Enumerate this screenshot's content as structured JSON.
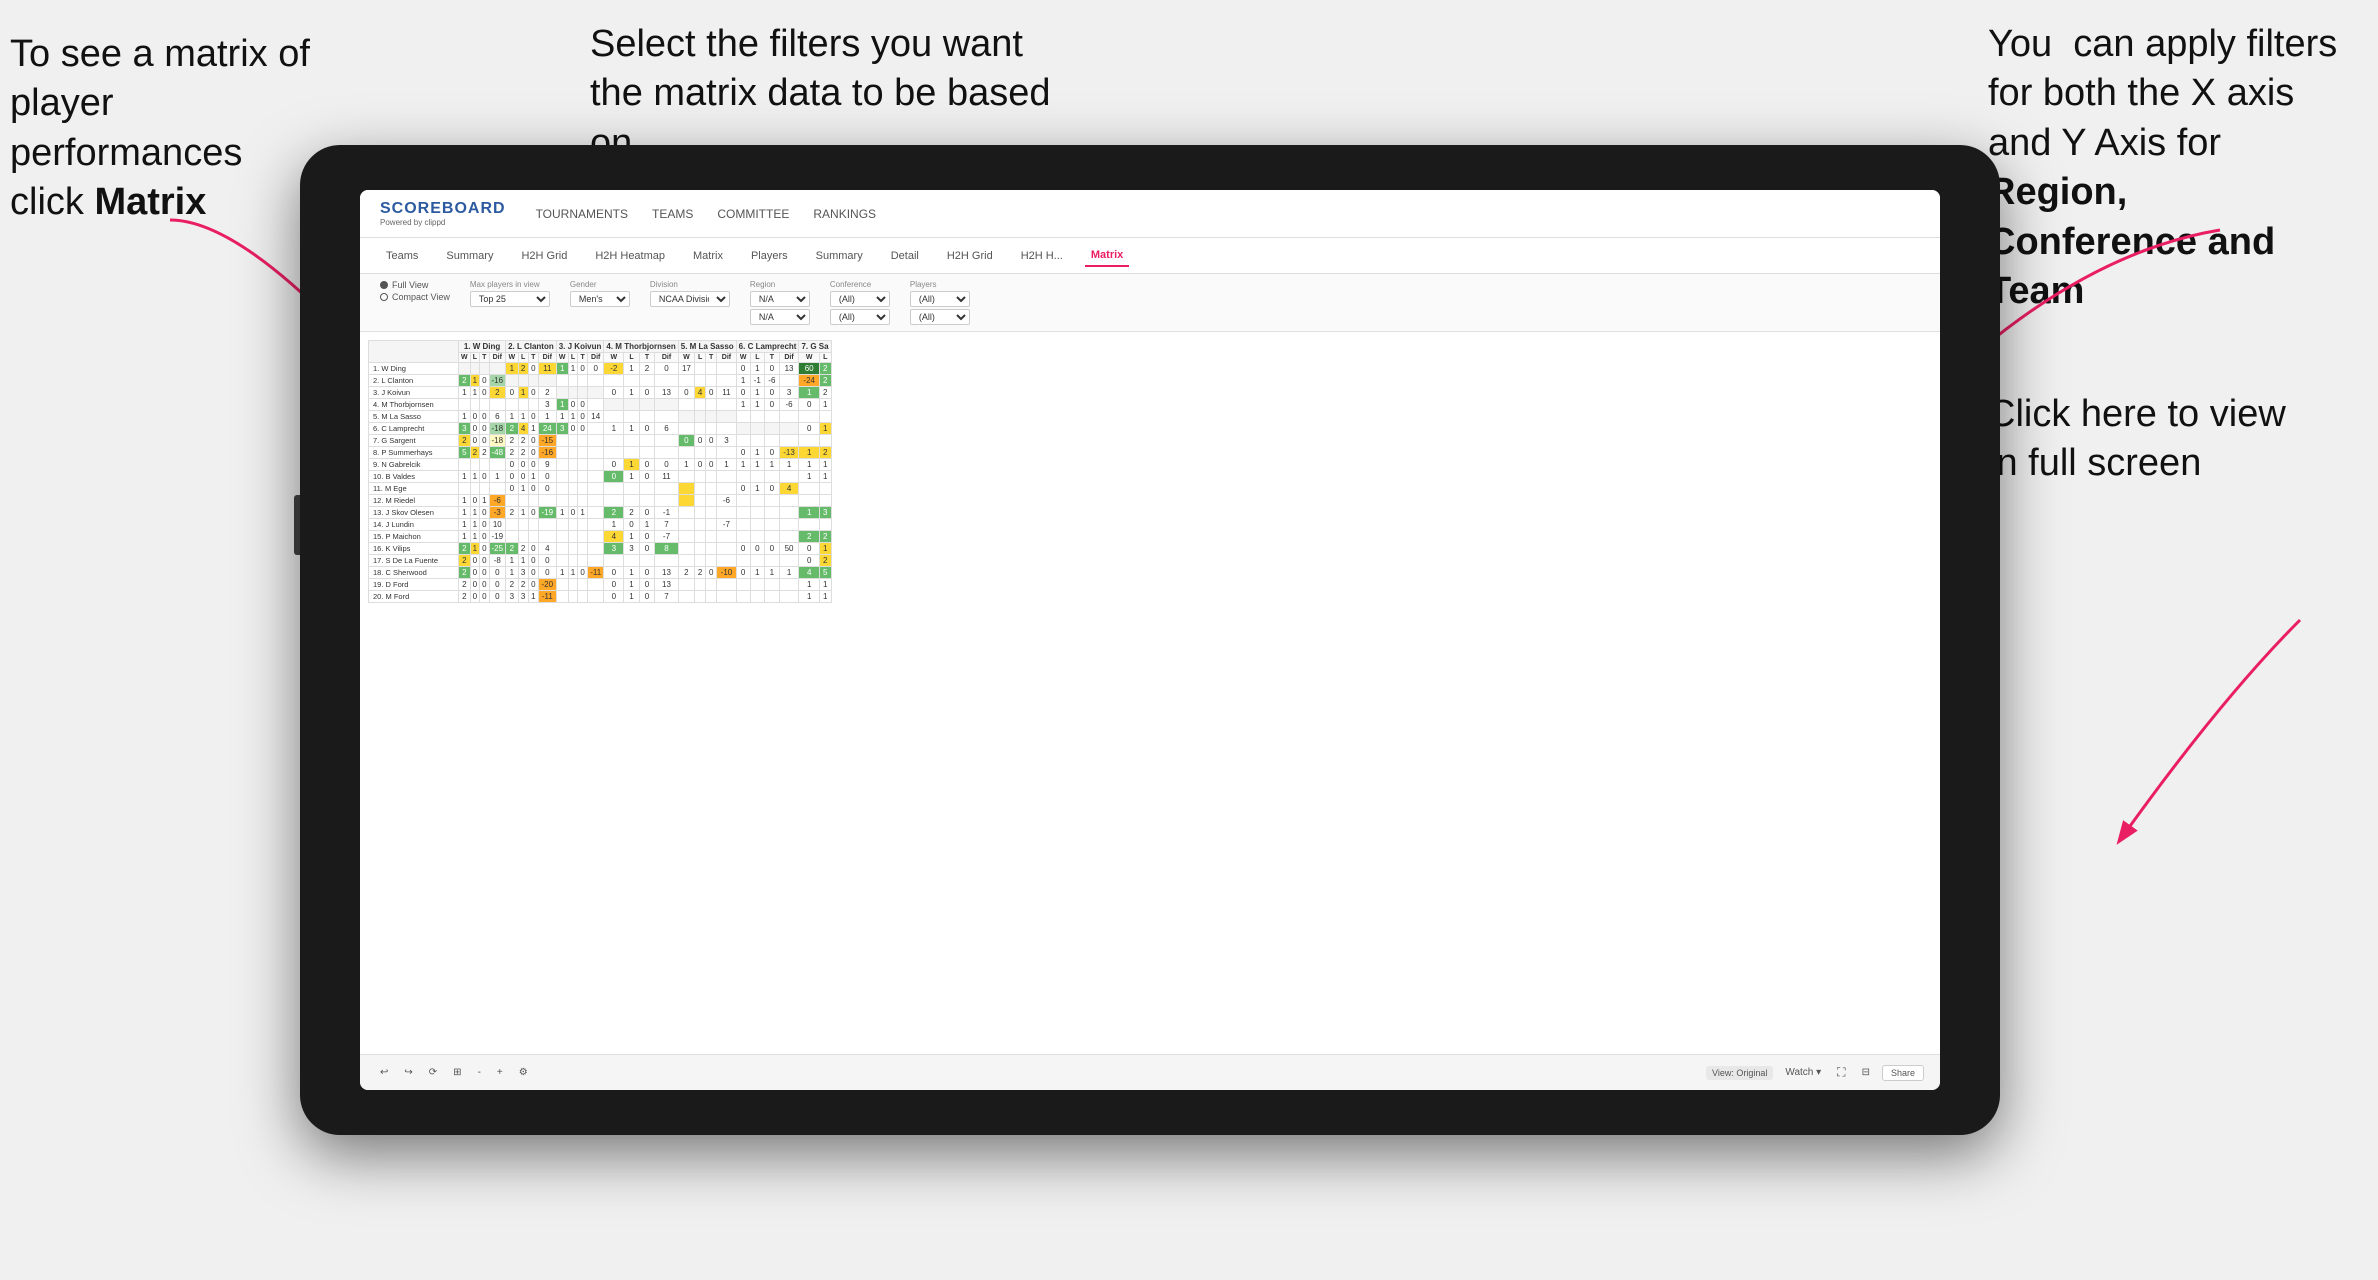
{
  "annotations": {
    "left": {
      "line1": "To see a matrix of",
      "line2": "player performances",
      "line3": "click ",
      "bold": "Matrix"
    },
    "center": {
      "text": "Select the filters you want the matrix data to be based on"
    },
    "right": {
      "line1": "You  can apply filters for both the X axis and Y Axis for ",
      "bold1": "Region,",
      "line2": " ",
      "bold2": "Conference and",
      "line3": " ",
      "bold3": "Team"
    },
    "bottom_right": {
      "line1": "Click here to view",
      "line2": "in full screen"
    }
  },
  "app": {
    "logo": "SCOREBOARD",
    "logo_sub": "Powered by clippd",
    "nav_items": [
      "TOURNAMENTS",
      "TEAMS",
      "COMMITTEE",
      "RANKINGS"
    ],
    "sub_nav_items": [
      "Teams",
      "Summary",
      "H2H Grid",
      "H2H Heatmap",
      "Matrix",
      "Players",
      "Summary",
      "Detail",
      "H2H Grid",
      "H2H H...",
      "Matrix"
    ],
    "active_tab": "Matrix",
    "filters": {
      "view_options": [
        "Full View",
        "Compact View"
      ],
      "selected_view": "Full View",
      "max_players_label": "Max players in view",
      "max_players_value": "Top 25",
      "gender_label": "Gender",
      "gender_value": "Men's",
      "division_label": "Division",
      "division_value": "NCAA Division I",
      "region_label": "Region",
      "region_value1": "N/A",
      "region_value2": "N/A",
      "conference_label": "Conference",
      "conference_value1": "(All)",
      "conference_value2": "(All)",
      "players_label": "Players",
      "players_value1": "(All)",
      "players_value2": "(All)"
    },
    "column_headers": [
      "1. W Ding",
      "2. L Clanton",
      "3. J Koivun",
      "4. M Thorbjornsen",
      "5. M La Sasso",
      "6. C Lamprecht",
      "7. G Sa"
    ],
    "sub_headers": [
      "W",
      "L",
      "T",
      "Dif"
    ],
    "players": [
      "1. W Ding",
      "2. L Clanton",
      "3. J Koivun",
      "4. M Thorbjornsen",
      "5. M La Sasso",
      "6. C Lamprecht",
      "7. G Sargent",
      "8. P Summerhays",
      "9. N Gabrelcik",
      "10. B Valdes",
      "11. M Ege",
      "12. M Riedel",
      "13. J Skov Olesen",
      "14. J Lundin",
      "15. P Maichon",
      "16. K Vilips",
      "17. S De La Fuente",
      "18. C Sherwood",
      "19. D Ford",
      "20. M Ford"
    ],
    "toolbar": {
      "view_label": "View: Original",
      "watch_label": "Watch ▾",
      "share_label": "Share"
    }
  }
}
